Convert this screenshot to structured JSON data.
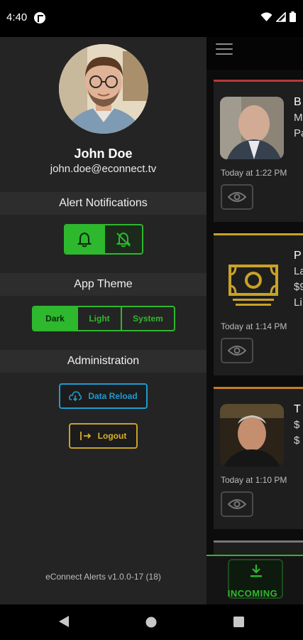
{
  "status_bar": {
    "time": "4:40"
  },
  "profile": {
    "name": "John Doe",
    "email": "john.doe@econnect.tv"
  },
  "sections": {
    "alerts": "Alert Notifications",
    "theme": "App Theme",
    "admin": "Administration"
  },
  "theme_options": [
    "Dark",
    "Light",
    "System"
  ],
  "theme_selected": "Dark",
  "notifications_selected": "bell-on",
  "buttons": {
    "data_reload": "Data Reload",
    "logout": "Logout"
  },
  "version": "eConnect Alerts v1.0.0-17 (18)",
  "cards": [
    {
      "time": "Today at 1:22 PM",
      "lines": [
        "B",
        "M",
        "Pa"
      ],
      "accent": "#b53a3a"
    },
    {
      "time": "Today at 1:14 PM",
      "lines": [
        "P",
        "La",
        "$9",
        "Li"
      ],
      "accent": "#c9a227"
    },
    {
      "time": "Today at 1:10 PM",
      "lines": [
        "T",
        "$",
        "$"
      ],
      "accent": "#c97a27"
    }
  ],
  "bottom_tab": {
    "label": "INCOMING"
  },
  "colors": {
    "green": "#2eb82e",
    "blue": "#1f9bd1",
    "gold": "#c9a227",
    "drawer": "#242424"
  }
}
